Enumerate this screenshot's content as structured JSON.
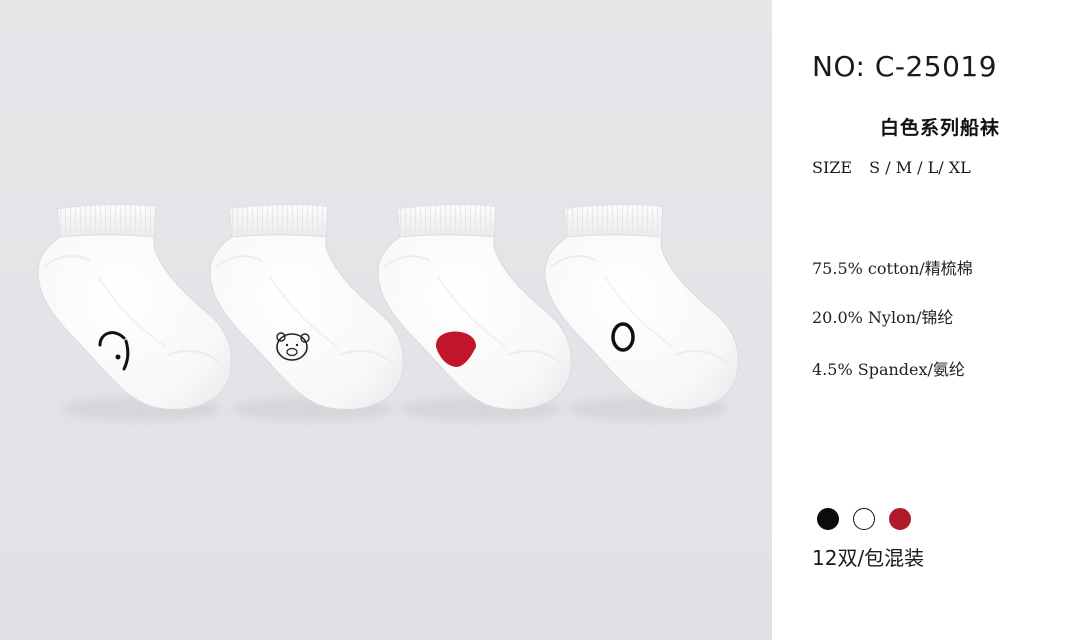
{
  "product": {
    "number": "NO: C-25019",
    "series": "白色系列船袜",
    "size_label": "SIZE",
    "sizes": "S / M / L/ XL"
  },
  "materials": [
    "75.5% cotton/精梳棉",
    "20.0% Nylon/锦纶",
    "4.5% Spandex/氨纶"
  ],
  "color_options": [
    {
      "name": "black",
      "hex": "#0b0b0b"
    },
    {
      "name": "white",
      "hex": "#ffffff"
    },
    {
      "name": "red",
      "hex": "#b01a2a"
    }
  ],
  "pack": "12双/包混装",
  "photo": {
    "background": "#e5e5e9",
    "socks": [
      {
        "pattern": "black-curve"
      },
      {
        "pattern": "bear-face-outline"
      },
      {
        "pattern": "red-semicircle"
      },
      {
        "pattern": "black-ring"
      }
    ]
  }
}
